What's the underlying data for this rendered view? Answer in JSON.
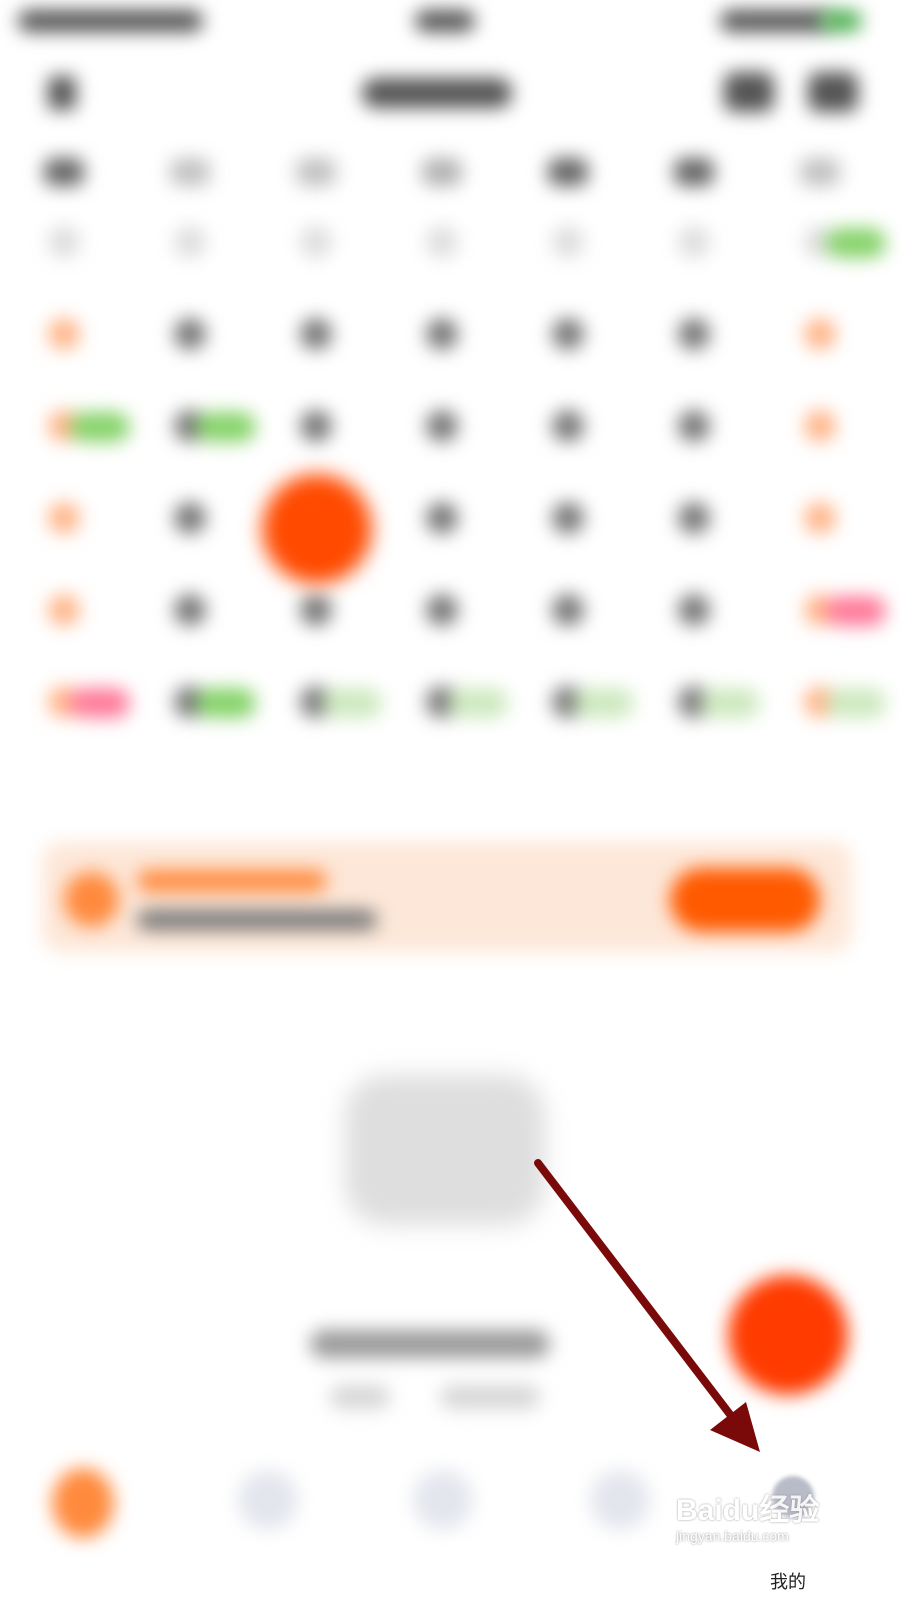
{
  "bottom_nav": {
    "tabs": [
      {
        "id": "home",
        "label": ""
      },
      {
        "id": "tab2",
        "label": ""
      },
      {
        "id": "tab3",
        "label": ""
      },
      {
        "id": "tab4",
        "label": ""
      },
      {
        "id": "mine",
        "label": "我的"
      }
    ]
  },
  "watermark": {
    "brand": "Baidu经验",
    "url": "jingyan.baidu.com"
  },
  "colors": {
    "accent": "#ff4a00",
    "banner_bg": "#fde7d8",
    "annotation_arrow": "#7a0a0a"
  }
}
